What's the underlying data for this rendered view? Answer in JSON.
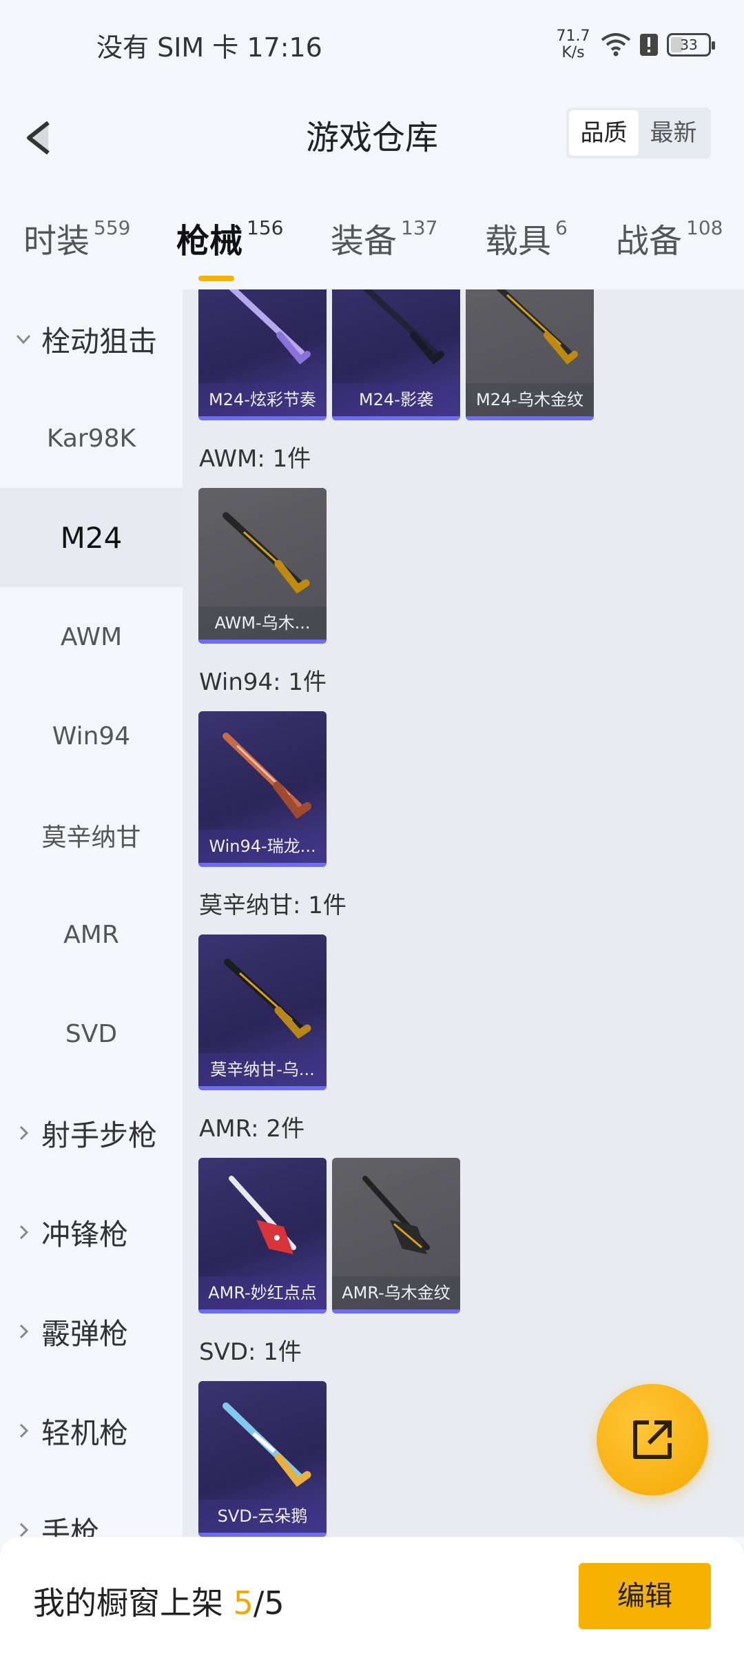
{
  "status_bar": {
    "carrier_time": "没有 SIM 卡 17:16",
    "net_speed_value": "71.7",
    "net_speed_unit": "K/s",
    "battery_level": "33",
    "icons": [
      "wifi-icon",
      "alert-icon",
      "battery-icon"
    ]
  },
  "header": {
    "back_icon": "chevron-left-icon",
    "title": "游戏仓库",
    "sort_options": [
      "品质",
      "最新"
    ],
    "sort_selected": "品质"
  },
  "tabs": [
    {
      "label": "时装",
      "count": "559"
    },
    {
      "label": "枪械",
      "count": "156",
      "active": true
    },
    {
      "label": "装备",
      "count": "137"
    },
    {
      "label": "载具",
      "count": "6"
    },
    {
      "label": "战备",
      "count": "108"
    }
  ],
  "sidebar": {
    "items": [
      {
        "label": "栓动狙击",
        "type": "group",
        "expanded": true
      },
      {
        "label": "Kar98K",
        "type": "item"
      },
      {
        "label": "M24",
        "type": "item",
        "selected": true
      },
      {
        "label": "AWM",
        "type": "item"
      },
      {
        "label": "Win94",
        "type": "item"
      },
      {
        "label": "莫辛纳甘",
        "type": "item"
      },
      {
        "label": "AMR",
        "type": "item"
      },
      {
        "label": "SVD",
        "type": "item"
      },
      {
        "label": "射手步枪",
        "type": "group",
        "expanded": false
      },
      {
        "label": "冲锋枪",
        "type": "group",
        "expanded": false
      },
      {
        "label": "霰弹枪",
        "type": "group",
        "expanded": false
      },
      {
        "label": "轻机枪",
        "type": "group",
        "expanded": false
      },
      {
        "label": "手枪",
        "type": "group",
        "expanded": false
      }
    ]
  },
  "content": {
    "groups": [
      {
        "label": "",
        "items": [
          {
            "name": "M24-炫彩节奏",
            "style": "purple"
          },
          {
            "name": "M24-影袭",
            "style": "purple"
          },
          {
            "name": "M24-乌木金纹",
            "style": "gray"
          }
        ]
      },
      {
        "label": "AWM: 1件",
        "items": [
          {
            "name": "AWM-乌木...",
            "style": "gray"
          }
        ]
      },
      {
        "label": "Win94: 1件",
        "items": [
          {
            "name": "Win94-瑞龙...",
            "style": "purple"
          }
        ]
      },
      {
        "label": "莫辛纳甘: 1件",
        "items": [
          {
            "name": "莫辛纳甘-乌...",
            "style": "purple"
          }
        ]
      },
      {
        "label": "AMR: 2件",
        "items": [
          {
            "name": "AMR-妙红点点",
            "style": "purple"
          },
          {
            "name": "AMR-乌木金纹",
            "style": "gray"
          }
        ]
      },
      {
        "label": "SVD: 1件",
        "items": [
          {
            "name": "SVD-云朵鹅",
            "style": "purple"
          }
        ]
      }
    ]
  },
  "fab": {
    "icon": "share-icon"
  },
  "bottom_bar": {
    "text_prefix": "我的橱窗上架 ",
    "current": "5",
    "separator": "/",
    "total": "5",
    "edit_label": "编辑"
  },
  "colors": {
    "accent": "#f5b400",
    "card_purple": "#2b2558",
    "card_gray": "#55555b",
    "rarity_bar": "#6e6cf0"
  }
}
